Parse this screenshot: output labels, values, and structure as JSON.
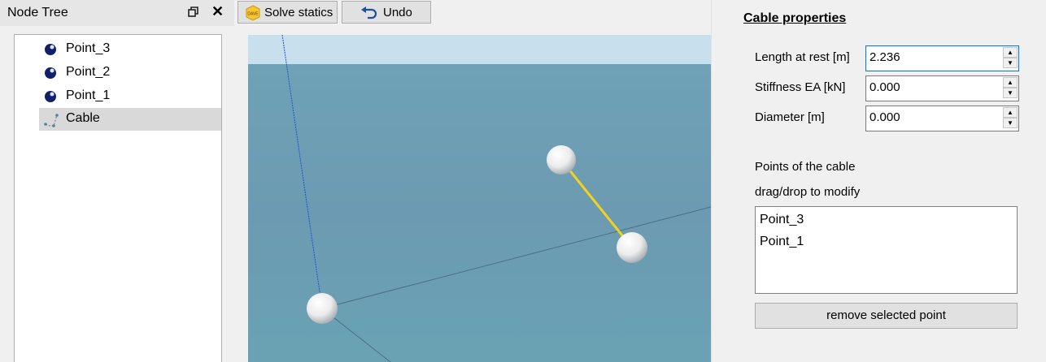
{
  "tree": {
    "title": "Node Tree",
    "items": [
      {
        "label": "Point_3",
        "icon": "point-icon"
      },
      {
        "label": "Point_2",
        "icon": "point-icon"
      },
      {
        "label": "Point_1",
        "icon": "point-icon"
      },
      {
        "label": "Cable",
        "icon": "cable-icon",
        "selected": true
      }
    ]
  },
  "toolbar": {
    "solve_label": "Solve statics",
    "solve_icon_text": "DAVE",
    "undo_label": "Undo"
  },
  "props": {
    "title": "Cable properties",
    "fields": [
      {
        "label": "Length at rest [m]",
        "value": "2.236"
      },
      {
        "label": "Stiffness EA [kN]",
        "value": "0.000"
      },
      {
        "label": "Diameter [m]",
        "value": "0.000"
      }
    ],
    "points_heading": "Points of the cable",
    "points_hint": "drag/drop to modify",
    "points": [
      "Point_3",
      "Point_1"
    ],
    "remove_label": "remove selected point"
  },
  "colors": {
    "sky": "#c8dfee",
    "water": "#6c9fb4",
    "cable": "#f2d21b",
    "selection": "#d9d9d9"
  }
}
